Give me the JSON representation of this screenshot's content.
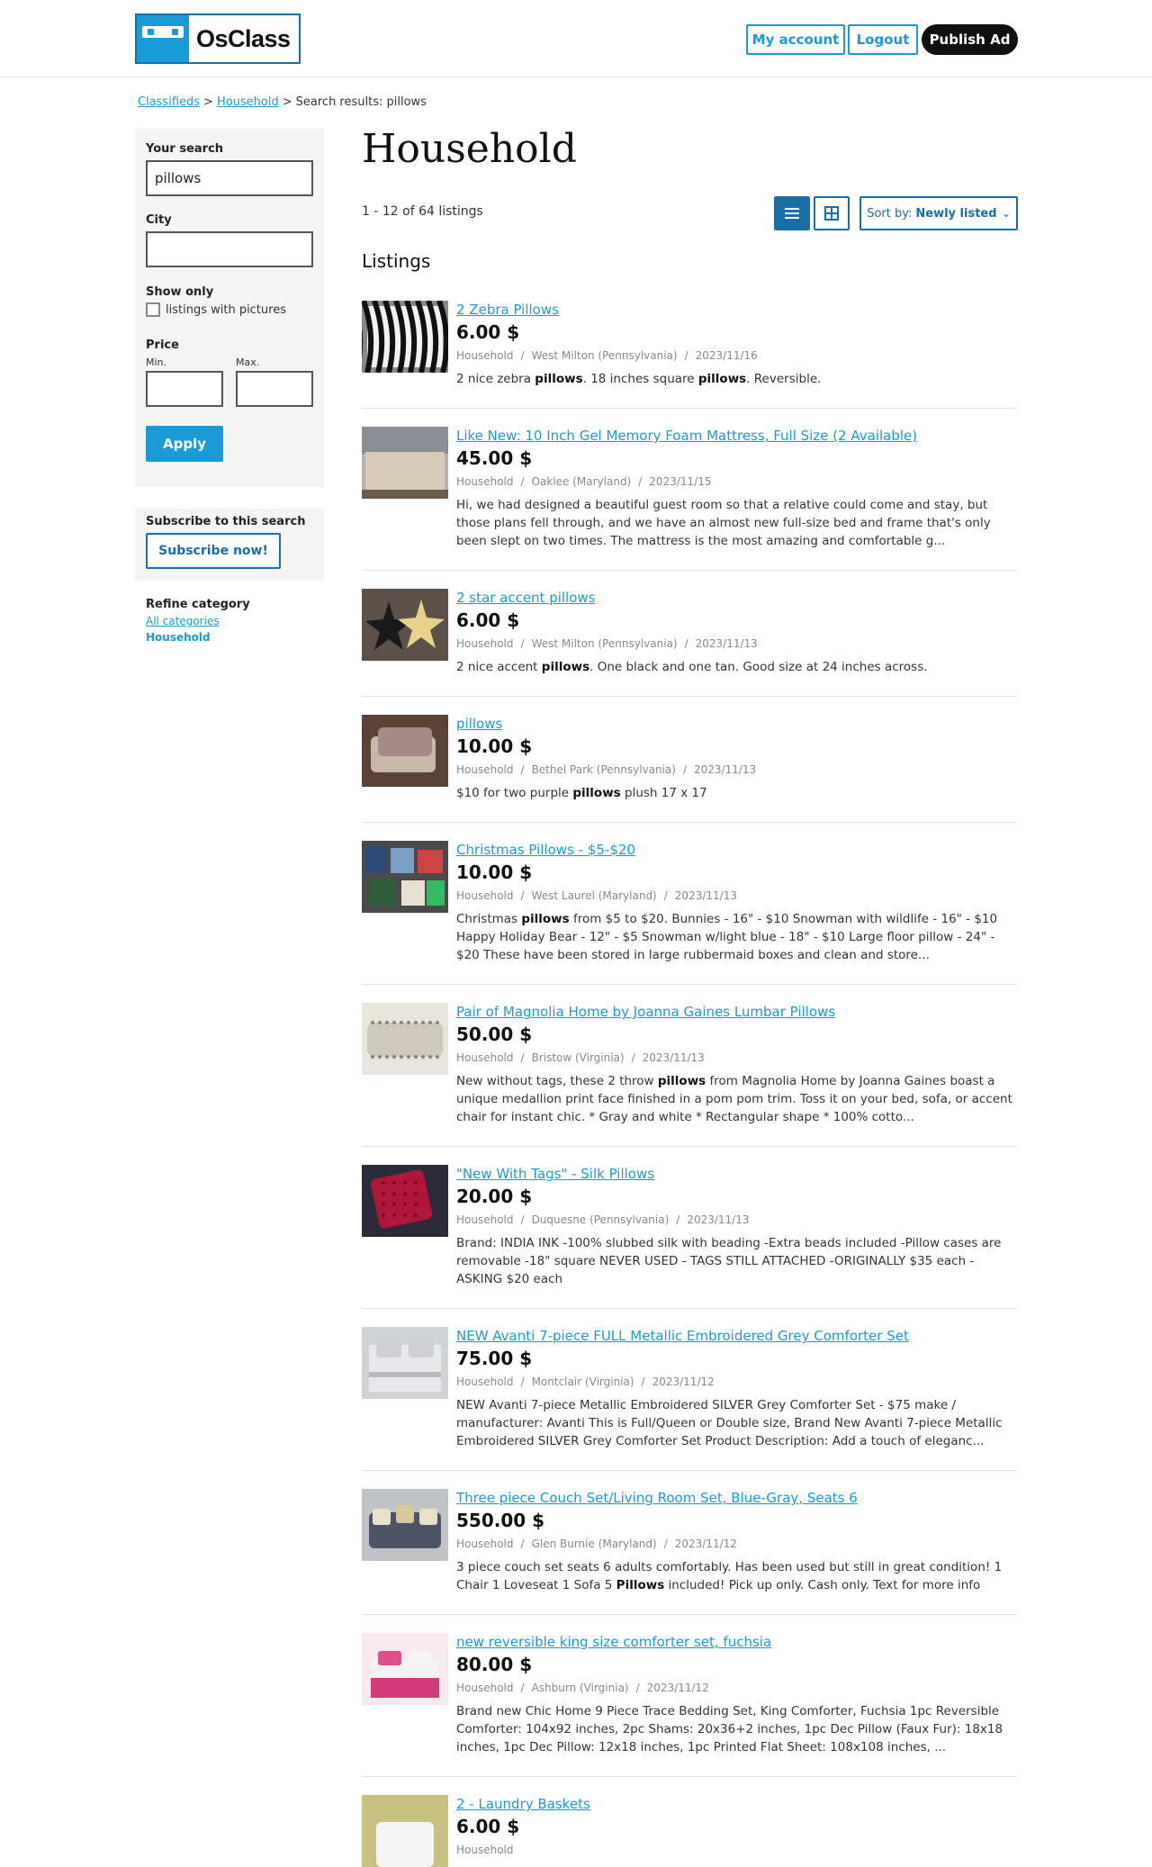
{
  "header": {
    "logo_text": "OsClass",
    "my_account": "My account",
    "logout": "Logout",
    "publish": "Publish Ad"
  },
  "breadcrumb": {
    "item1": "Classifieds",
    "sep1": ">",
    "item2": "Household",
    "sep2": ">",
    "current": "Search results: pillows"
  },
  "sidebar": {
    "your_search_label": "Your search",
    "your_search_value": "pillows",
    "city_label": "City",
    "city_value": "",
    "show_only_label": "Show only",
    "pictures_label": "listings with pictures",
    "price_label": "Price",
    "min_label": "Min.",
    "max_label": "Max.",
    "apply": "Apply",
    "subscribe_label": "Subscribe to this search",
    "subscribe_button": "Subscribe now!",
    "refine_label": "Refine category",
    "all_categories": "All categories",
    "household": "Household"
  },
  "main": {
    "title": "Household",
    "count": "1 - 12 of 64 listings",
    "sort_prefix": "Sort by:",
    "sort_value": "Newly listed",
    "listings_heading": "Listings"
  },
  "listings": [
    {
      "title": "2 Zebra Pillows",
      "price": "6.00 $",
      "category": "Household",
      "location": "West Milton (Pennsylvania)",
      "date": "2023/11/16",
      "desc": "2 nice zebra <b>pillows</b>. 18 inches square <b>pillows</b>. Reversible.",
      "thumb": "zebra"
    },
    {
      "title": "Like New: 10 Inch Gel Memory Foam Mattress, Full Size (2 Available)",
      "price": "45.00 $",
      "category": "Household",
      "location": "Oaklee (Maryland)",
      "date": "2023/11/15",
      "desc": "Hi, we had designed a beautiful guest room so that a relative could come and stay, but those plans fell through, and we have an almost new full-size bed and frame that's only been slept on two times. The mattress is the most amazing and comfortable g...",
      "thumb": "bed"
    },
    {
      "title": "2 star accent pillows",
      "price": "6.00 $",
      "category": "Household",
      "location": "West Milton (Pennsylvania)",
      "date": "2023/11/13",
      "desc": "2 nice accent <b>pillows</b>. One black and one tan. Good size at 24 inches across.",
      "thumb": "stars"
    },
    {
      "title": "pillows",
      "price": "10.00 $",
      "category": "Household",
      "location": "Bethel Park (Pennsylvania)",
      "date": "2023/11/13",
      "desc": "$10 for two purple <b>pillows</b> plush 17 x 17",
      "thumb": "purple"
    },
    {
      "title": "Christmas Pillows - $5-$20",
      "price": "10.00 $",
      "category": "Household",
      "location": "West Laurel (Maryland)",
      "date": "2023/11/13",
      "desc": "Christmas <b>pillows</b> from $5 to $20. Bunnies - 16\" - $10 Snowman with wildlife - 16\" - $10 Happy Holiday Bear - 12\" - $5 Snowman w/light blue - 18\" - $10 Large floor pillow - 24\" - $20 These have been stored in large rubbermaid boxes and clean and store...",
      "thumb": "xmas"
    },
    {
      "title": "Pair of Magnolia Home by Joanna Gaines Lumbar Pillows",
      "price": "50.00 $",
      "category": "Household",
      "location": "Bristow (Virginia)",
      "date": "2023/11/13",
      "desc": "New without tags, these 2 throw <b>pillows</b> from Magnolia Home by Joanna Gaines boast a unique medallion print face finished in a pom pom trim. Toss it on your bed, sofa, or accent chair for instant chic. * Gray and white * Rectangular shape * 100% cotto...",
      "thumb": "lumbar"
    },
    {
      "title": "\"New With Tags\" - Silk Pillows",
      "price": "20.00 $",
      "category": "Household",
      "location": "Duquesne (Pennsylvania)",
      "date": "2023/11/13",
      "desc": "Brand: INDIA INK -100% slubbed silk with beading -Extra beads included -Pillow cases are removable -18\" square NEVER USED - TAGS STILL ATTACHED -ORIGINALLY $35 each - ASKING $20 each",
      "thumb": "silk"
    },
    {
      "title": "NEW Avanti 7-piece FULL Metallic Embroidered Grey Comforter Set",
      "price": "75.00 $",
      "category": "Household",
      "location": "Montclair (Virginia)",
      "date": "2023/11/12",
      "desc": "NEW Avanti 7-piece Metallic Embroidered SILVER Grey Comforter Set - $75 make / manufacturer: Avanti This is Full/Queen or Double size, Brand New Avanti 7-piece Metallic Embroidered SILVER Grey Comforter Set Product Description: Add a touch of eleganc...",
      "thumb": "grey"
    },
    {
      "title": "Three piece Couch Set/Living Room Set, Blue-Gray, Seats 6",
      "price": "550.00 $",
      "category": "Household",
      "location": "Glen Burnie (Maryland)",
      "date": "2023/11/12",
      "desc": "3 piece couch set seats 6 adults comfortably. Has been used but still in great condition! 1 Chair 1 Loveseat 1 Sofa 5 <b>Pillows</b> included! Pick up only. Cash only. Text for more info",
      "thumb": "couch"
    },
    {
      "title": "new reversible king size comforter set, fuchsia",
      "price": "80.00 $",
      "category": "Household",
      "location": "Ashburn (Virginia)",
      "date": "2023/11/12",
      "desc": "Brand new Chic Home 9 Piece Trace Bedding Set, King Comforter, Fuchsia 1pc Reversible Comforter: 104x92 inches, 2pc Shams: 20x36+2 inches, 1pc Dec Pillow (Faux Fur): 18x18 inches, 1pc Dec Pillow: 12x18 inches, 1pc Printed Flat Sheet: 108x108 inches, ...",
      "thumb": "fuchsia"
    },
    {
      "title": "2 - Laundry Baskets",
      "price": "6.00 $",
      "category": "Household",
      "location": "",
      "date": "",
      "desc": "",
      "thumb": "laundry"
    }
  ]
}
